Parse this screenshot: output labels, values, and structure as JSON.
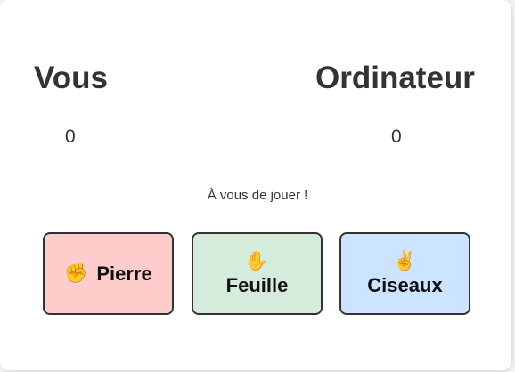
{
  "players": {
    "you": {
      "label": "Vous",
      "score": "0"
    },
    "computer": {
      "label": "Ordinateur",
      "score": "0"
    }
  },
  "status_message": "À vous de jouer !",
  "choices": [
    {
      "label": "Pierre",
      "emoji": "✊",
      "icon": "raised-fist-icon",
      "color": "#ffcccc"
    },
    {
      "label": "Feuille",
      "emoji": "✋",
      "icon": "raised-hand-icon",
      "color": "#d5ecdc"
    },
    {
      "label": "Ciseaux",
      "emoji": "✌️",
      "icon": "victory-hand-icon",
      "color": "#cce4ff"
    }
  ],
  "colors": {
    "text": "#333333",
    "border": "#333333",
    "card_background": "#ffffff"
  }
}
